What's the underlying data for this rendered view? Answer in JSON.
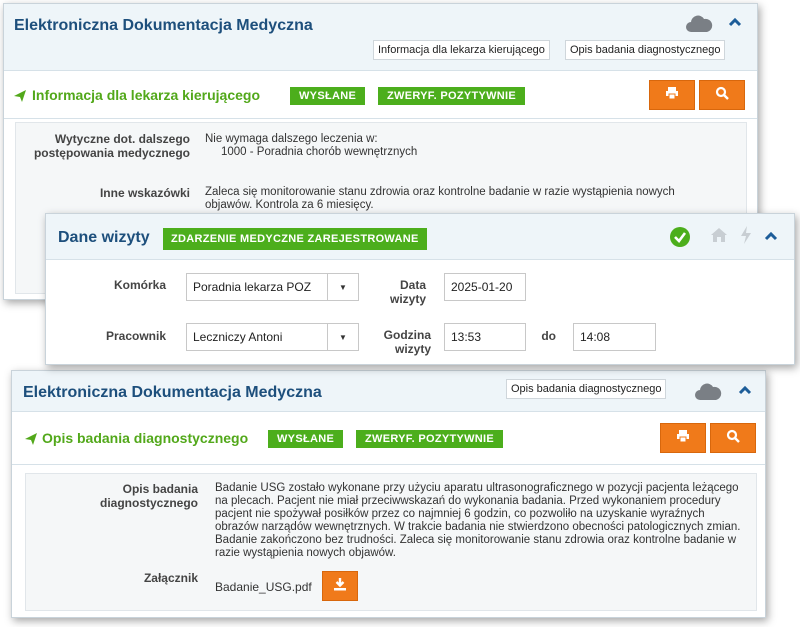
{
  "card1": {
    "header_title": "Elektroniczna Dokumentacja Medyczna",
    "tab_a": "Informacja dla lekarza kierującego",
    "tab_b": "Opis badania diagnostycznego",
    "section_title": "Informacja dla lekarza kierującego",
    "badge_sent": "WYSŁANE",
    "badge_verified": "ZWERYF. POZYTYWNIE",
    "row1_label": "Wytyczne dot. dalszego postępowania medycznego",
    "row1_line1": "Nie wymaga dalszego leczenia w:",
    "row1_line2": "1000 - Poradnia chorób wewnętrznych",
    "row2_label": "Inne wskazówki",
    "row2_value": "Zaleca się monitorowanie stanu zdrowia oraz kontrolne badanie w razie wystąpienia nowych objawów. Kontrola za 6 miesięcy."
  },
  "card2": {
    "title": "Dane wizyty",
    "badge": "ZDARZENIE MEDYCZNE ZAREJESTROWANE",
    "komorka_label": "Komórka",
    "komorka_value": "Poradnia lekarza POZ",
    "data_label": "Data wizyty",
    "data_value": "2025-01-20",
    "pracownik_label": "Pracownik",
    "pracownik_value": "Leczniczy Antoni",
    "godzina_label": "Godzina wizyty",
    "godzina_from": "13:53",
    "do_label": "do",
    "godzina_to": "14:08"
  },
  "card3": {
    "header_title": "Elektroniczna Dokumentacja Medyczna",
    "tab": "Opis badania diagnostycznego",
    "section_title": "Opis badania diagnostycznego",
    "badge_sent": "WYSŁANE",
    "badge_verified": "ZWERYF. POZYTYWNIE",
    "opis_label": "Opis badania diagnostycznego",
    "opis_value": "Badanie USG zostało wykonane przy użyciu aparatu ultrasonograficznego w pozycji pacjenta leżącego na plecach. Pacjent nie miał przeciwwskazań do wykonania badania. Przed wykonaniem procedury pacjent nie spożywał posiłków przez co najmniej 6 godzin, co pozwoliło na uzyskanie wyraźnych obrazów narządów wewnętrznych. W trakcie badania nie stwierdzono obecności patologicznych zmian. Badanie zakończono bez trudności. Zaleca się monitorowanie stanu zdrowia oraz kontrolne badanie w razie wystąpienia nowych objawów.",
    "zalacznik_label": "Załącznik",
    "file_name": "Badanie_USG.pdf"
  },
  "icons": [
    "cloud-icon",
    "chevron-up-icon",
    "print-icon",
    "search-icon",
    "send-icon",
    "check-circle-icon",
    "home-icon",
    "bolt-icon",
    "download-icon"
  ],
  "colors": {
    "accent_orange": "#f07a1a",
    "badge_green": "#4cae1c",
    "title_blue": "#1d4f7c",
    "green_text": "#52a81a"
  }
}
